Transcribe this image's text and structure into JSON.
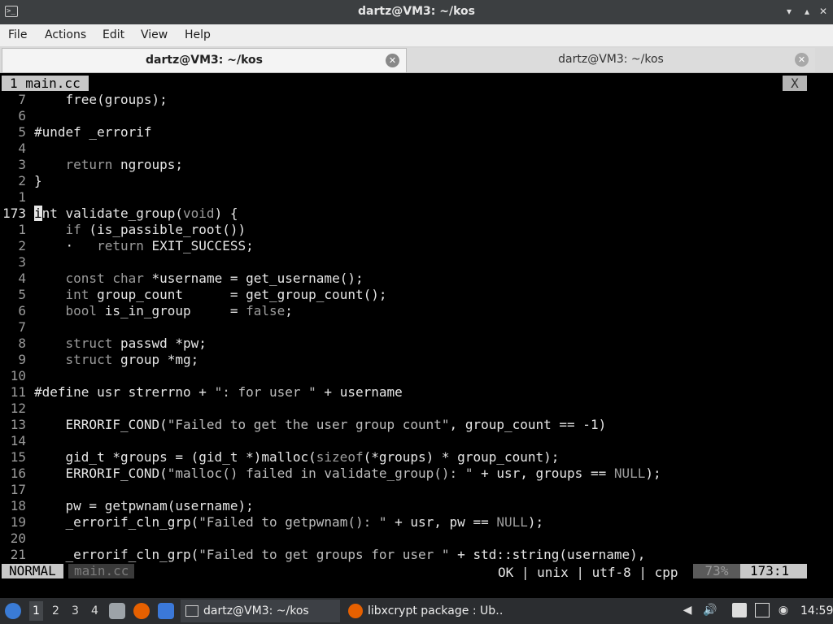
{
  "window": {
    "title": "dartz@VM3: ~/kos",
    "app_icon": "terminal-icon",
    "controls": [
      "minimize",
      "maximize",
      "close"
    ]
  },
  "menu": [
    "File",
    "Actions",
    "Edit",
    "View",
    "Help"
  ],
  "tabs": [
    {
      "label": "dartz@VM3: ~/kos",
      "active": true
    },
    {
      "label": "dartz@VM3: ~/kos",
      "active": false
    }
  ],
  "vim": {
    "tabline": {
      "label": "1 main.cc",
      "close": "X"
    },
    "lines": [
      {
        "num": "7",
        "code": "    free(groups);"
      },
      {
        "num": "6",
        "code": ""
      },
      {
        "num": "5",
        "code": "#undef _errorif"
      },
      {
        "num": "4",
        "code": ""
      },
      {
        "num": "3",
        "code": "    return ngroups;"
      },
      {
        "num": "2",
        "code": "}"
      },
      {
        "num": "1",
        "code": ""
      },
      {
        "num": "173",
        "code": "int validate_group(void) {",
        "current": true
      },
      {
        "num": "1",
        "code": "    if (is_passible_root())"
      },
      {
        "num": "2",
        "code": "    ·   return EXIT_SUCCESS;"
      },
      {
        "num": "3",
        "code": ""
      },
      {
        "num": "4",
        "code": "    const char *username = get_username();"
      },
      {
        "num": "5",
        "code": "    int group_count      = get_group_count();"
      },
      {
        "num": "6",
        "code": "    bool is_in_group     = false;"
      },
      {
        "num": "7",
        "code": ""
      },
      {
        "num": "8",
        "code": "    struct passwd *pw;"
      },
      {
        "num": "9",
        "code": "    struct group *mg;"
      },
      {
        "num": "10",
        "code": ""
      },
      {
        "num": "11",
        "code": "#define usr strerrno + \": for user \" + username"
      },
      {
        "num": "12",
        "code": ""
      },
      {
        "num": "13",
        "code": "    ERRORIF_COND(\"Failed to get the user group count\", group_count == -1)"
      },
      {
        "num": "14",
        "code": ""
      },
      {
        "num": "15",
        "code": "    gid_t *groups = (gid_t *)malloc(sizeof(*groups) * group_count);"
      },
      {
        "num": "16",
        "code": "    ERRORIF_COND(\"malloc() failed in validate_group(): \" + usr, groups == NULL);"
      },
      {
        "num": "17",
        "code": ""
      },
      {
        "num": "18",
        "code": "    pw = getpwnam(username);"
      },
      {
        "num": "19",
        "code": "    _errorif_cln_grp(\"Failed to getpwnam(): \" + usr, pw == NULL);"
      },
      {
        "num": "20",
        "code": ""
      },
      {
        "num": "21",
        "code": "    _errorif_cln_grp(\"Failed to get groups for user \" + std::string(username),"
      }
    ],
    "status": {
      "mode": "NORMAL",
      "file": "main.cc",
      "info": "OK | unix | utf-8 | cpp",
      "percent": "73%",
      "position": "173:1"
    }
  },
  "taskbar": {
    "menu_icon": "start-menu-icon",
    "workspaces": [
      "1",
      "2",
      "3",
      "4"
    ],
    "current_workspace": "1",
    "launchers": [
      "file-manager-icon",
      "firefox-icon",
      "desktop-icon"
    ],
    "tasks": [
      {
        "label": "dartz@VM3: ~/kos",
        "icon": "terminal-icon",
        "active": true
      },
      {
        "label": "libxcrypt package : Ub…",
        "icon": "firefox-icon",
        "active": false
      }
    ],
    "tray": [
      "notification-icon",
      "volume-icon",
      "clipboard-icon",
      "network-icon",
      "updates-icon"
    ],
    "clock": "14:59"
  }
}
